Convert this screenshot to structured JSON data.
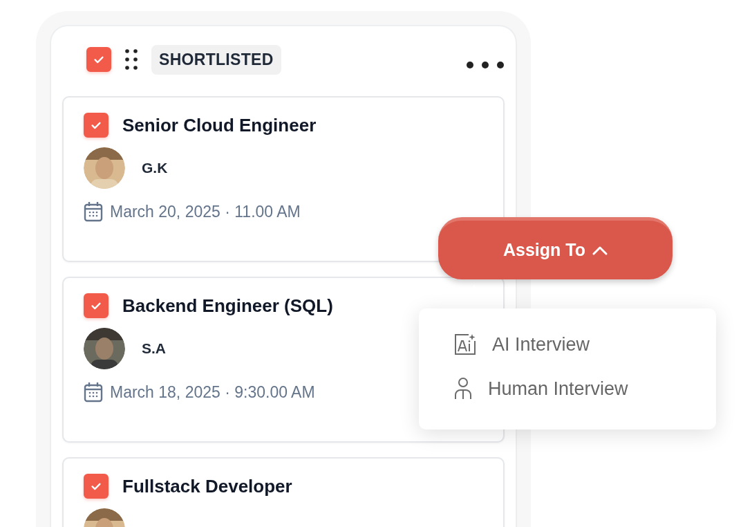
{
  "column": {
    "header_checked": true,
    "label": "SHORTLISTED"
  },
  "cards": [
    {
      "checked": true,
      "title": "Senior Cloud Engineer",
      "candidate": "G.K",
      "schedule": "March 20, 2025 · 11.00 AM"
    },
    {
      "checked": true,
      "title": "Backend Engineer (SQL)",
      "candidate": "S.A",
      "schedule": "March 18, 2025 · 9:30.00 AM"
    },
    {
      "checked": true,
      "title": "Fullstack Developer"
    }
  ],
  "assign_button": {
    "label": "Assign To",
    "expanded": true
  },
  "assign_menu": [
    {
      "kind": "ai",
      "label": "AI Interview"
    },
    {
      "kind": "human",
      "label": "Human Interview"
    }
  ]
}
